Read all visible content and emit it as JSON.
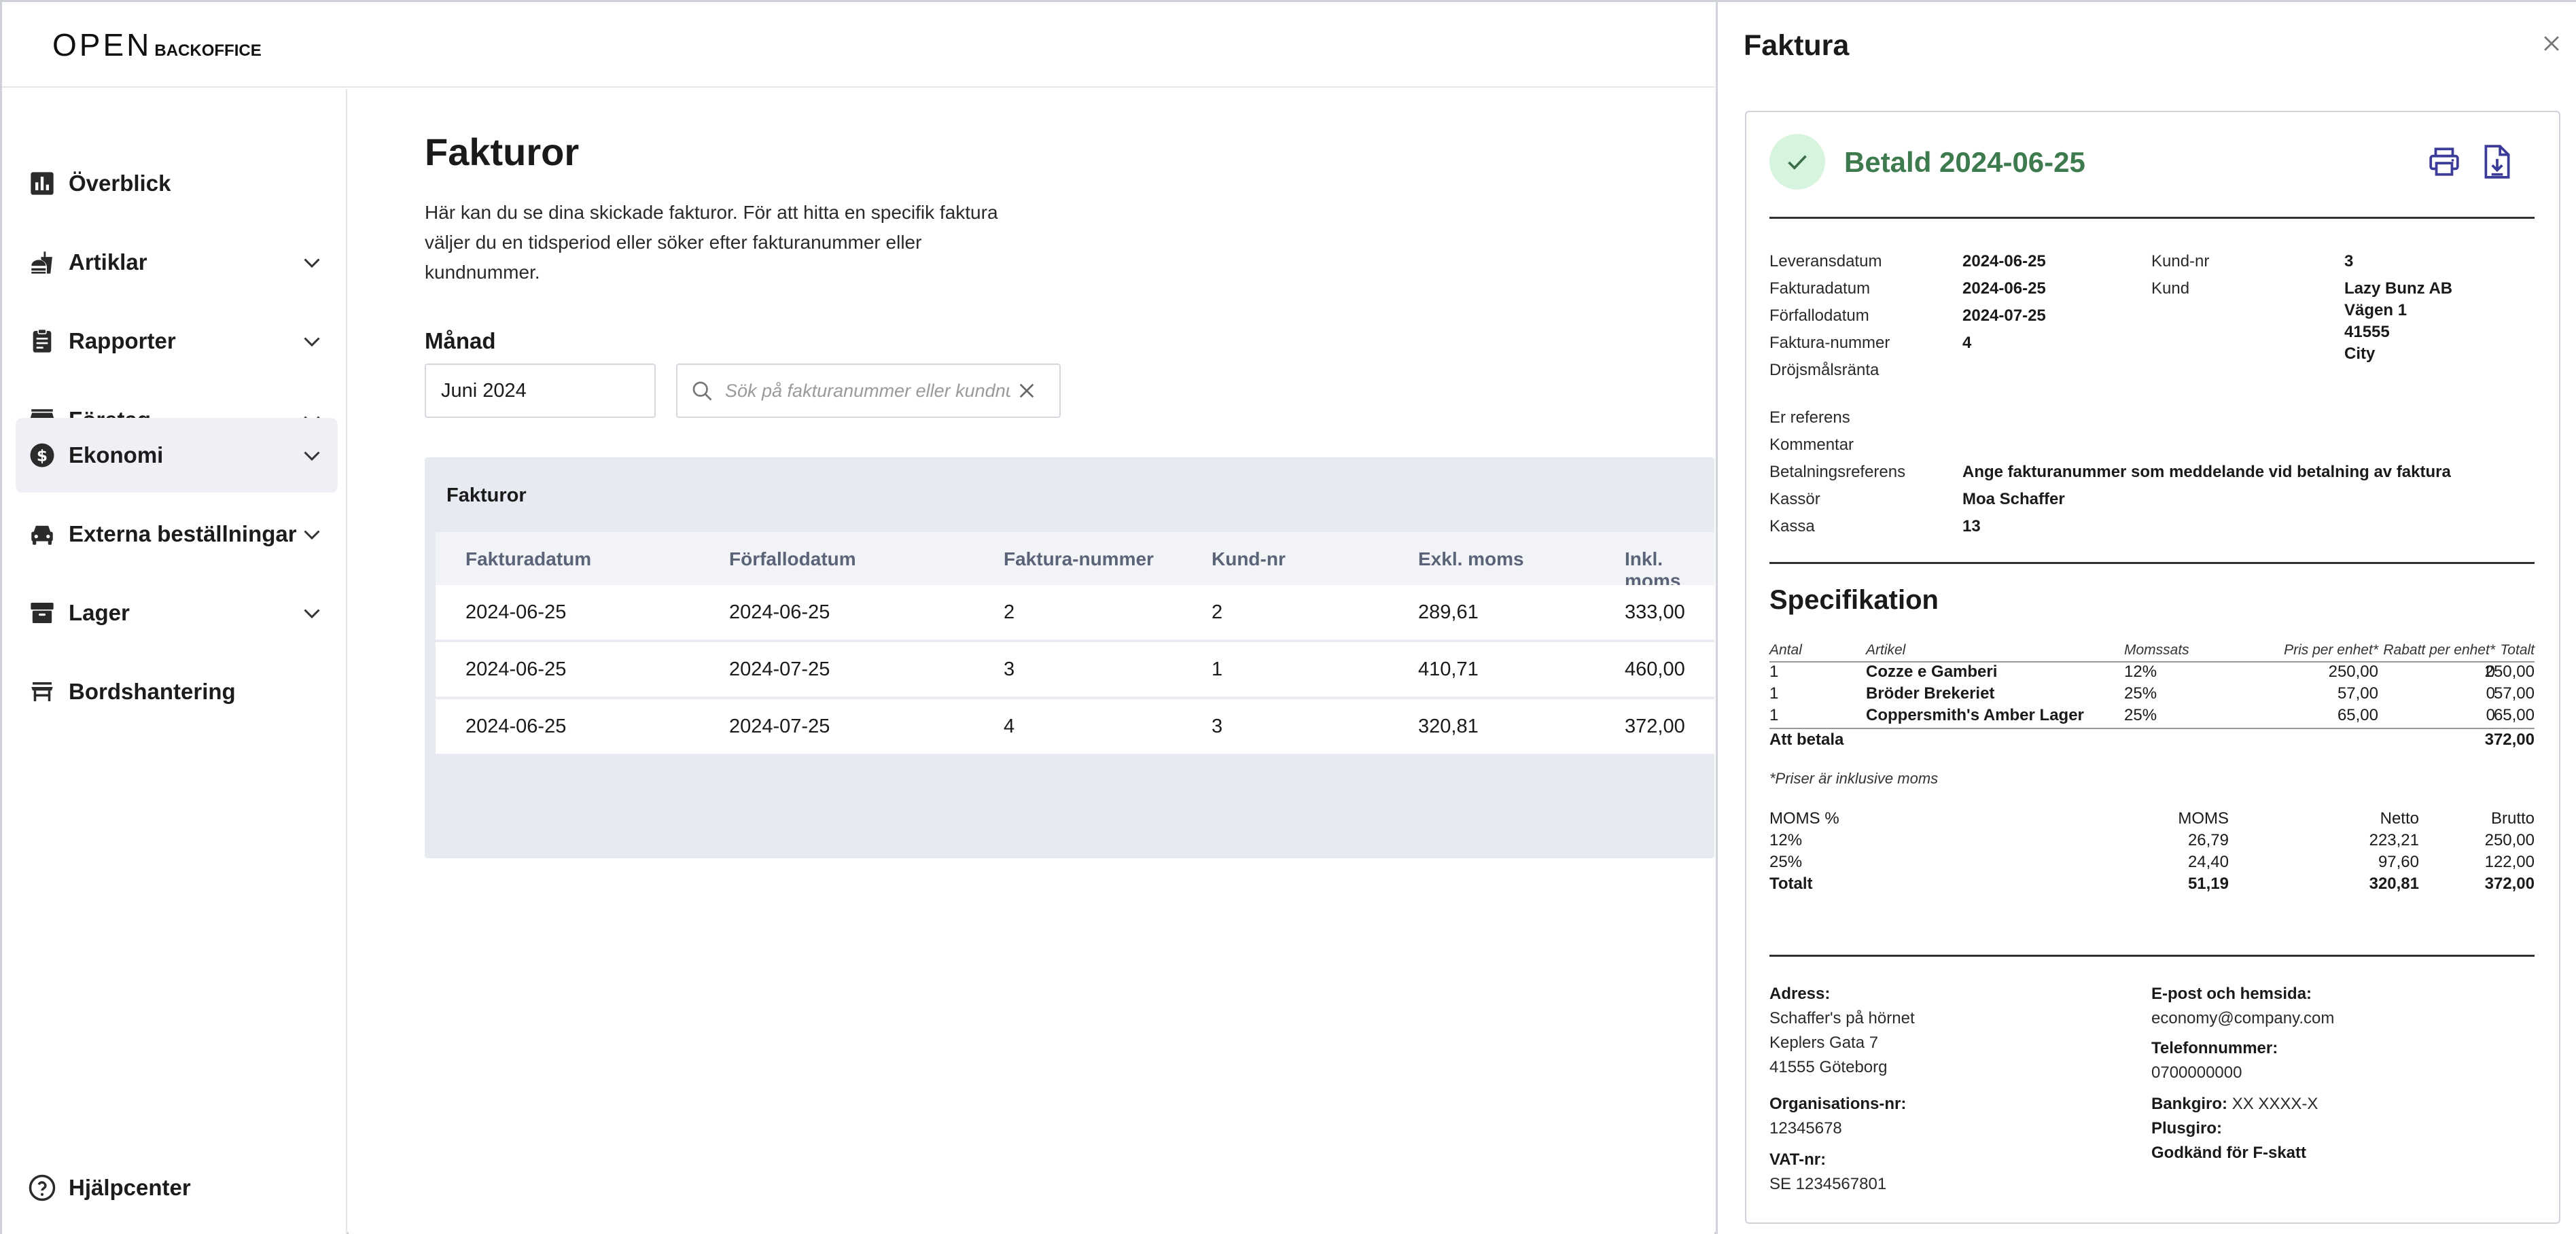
{
  "brand": {
    "logo_mark": "OPEN",
    "logo_sub": "BACKOFFICE"
  },
  "sidebar": {
    "items": [
      {
        "label": "Överblick",
        "icon": "bar-chart-icon"
      },
      {
        "label": "Artiklar",
        "icon": "fastfood-icon"
      },
      {
        "label": "Rapporter",
        "icon": "clipboard-icon"
      },
      {
        "label": "Företag",
        "icon": "store-icon"
      },
      {
        "label": "Ekonomi",
        "icon": "dollar-circle-icon"
      },
      {
        "label": "Externa beställningar",
        "icon": "car-icon"
      },
      {
        "label": "Lager",
        "icon": "archive-icon"
      },
      {
        "label": "Bordshantering",
        "icon": "table-icon"
      }
    ],
    "help": "Hjälpcenter"
  },
  "main": {
    "title": "Fakturor",
    "description": "Här kan du se dina skickade fakturor. För att hitta en specifik faktura väljer du en tidsperiod eller söker efter fakturanummer eller kundnummer.",
    "month_label": "Månad",
    "month_value": "Juni 2024",
    "search_placeholder": "Sök på fakturanummer eller kundnummer",
    "table": {
      "title": "Fakturor",
      "columns": [
        "Fakturadatum",
        "Förfallodatum",
        "Faktura-nummer",
        "Kund-nr",
        "Exkl. moms",
        "Inkl. moms"
      ],
      "rows": [
        [
          "2024-06-25",
          "2024-06-25",
          "2",
          "2",
          "289,61",
          "333,00"
        ],
        [
          "2024-06-25",
          "2024-07-25",
          "3",
          "1",
          "410,71",
          "460,00"
        ],
        [
          "2024-06-25",
          "2024-07-25",
          "4",
          "3",
          "320,81",
          "372,00"
        ]
      ]
    }
  },
  "drawer": {
    "title": "Faktura",
    "status": "Betald 2024-06-25",
    "status_color": "#3d7a4e",
    "details_left": [
      {
        "label": "Leveransdatum",
        "value": "2024-06-25"
      },
      {
        "label": "Fakturadatum",
        "value": "2024-06-25"
      },
      {
        "label": "Förfallodatum",
        "value": "2024-07-25"
      },
      {
        "label": "Faktura-nummer",
        "value": "4"
      },
      {
        "label": "Dröjsmålsränta",
        "value": ""
      }
    ],
    "customer_no_label": "Kund-nr",
    "customer_no": "3",
    "customer_label": "Kund",
    "customer_lines": [
      "Lazy Bunz AB",
      "Vägen 1",
      "41555",
      "City"
    ],
    "details_ref": [
      {
        "label": "Er referens",
        "value": ""
      },
      {
        "label": "Kommentar",
        "value": ""
      },
      {
        "label": "Betalningsreferens",
        "value": "Ange fakturanummer som meddelande vid betalning av faktura"
      },
      {
        "label": "Kassör",
        "value": "Moa Schaffer"
      },
      {
        "label": "Kassa",
        "value": "13"
      }
    ],
    "spec": {
      "title": "Specifikation",
      "headers": [
        "Antal",
        "Artikel",
        "Momssats",
        "Pris per enhet*",
        "Rabatt per enhet*",
        "Totalt"
      ],
      "rows": [
        [
          "1",
          "Cozze e Gamberi",
          "12%",
          "250,00",
          "0",
          "250,00"
        ],
        [
          "1",
          "Bröder Brekeriet",
          "25%",
          "57,00",
          "0",
          "57,00"
        ],
        [
          "1",
          "Coppersmith's Amber Lager",
          "25%",
          "65,00",
          "0",
          "65,00"
        ]
      ],
      "total_label": "Att betala",
      "total": "372,00",
      "note": "*Priser är inklusive moms"
    },
    "vat": {
      "headers": [
        "MOMS %",
        "MOMS",
        "Netto",
        "Brutto"
      ],
      "rows": [
        [
          "12%",
          "26,79",
          "223,21",
          "250,00"
        ],
        [
          "25%",
          "24,40",
          "97,60",
          "122,00"
        ]
      ],
      "total": [
        "Totalt",
        "51,19",
        "320,81",
        "372,00"
      ]
    },
    "footer": {
      "address_label": "Adress:",
      "address_lines": [
        "Schaffer's på hörnet",
        "Keplers Gata 7",
        "41555 Göteborg"
      ],
      "org_label": "Organisations-nr:",
      "org_value": "12345678",
      "vat_label": "VAT-nr:",
      "vat_value": "SE 1234567801",
      "email_label": "E-post och hemsida:",
      "email_value": "economy@company.com",
      "phone_label": "Telefonnummer:",
      "phone_value": "0700000000",
      "bankgiro_label": "Bankgiro:",
      "bankgiro_value": "XX XXXX-X",
      "plusgiro_label": "Plusgiro:",
      "fskatt": "Godkänd för F-skatt"
    }
  }
}
